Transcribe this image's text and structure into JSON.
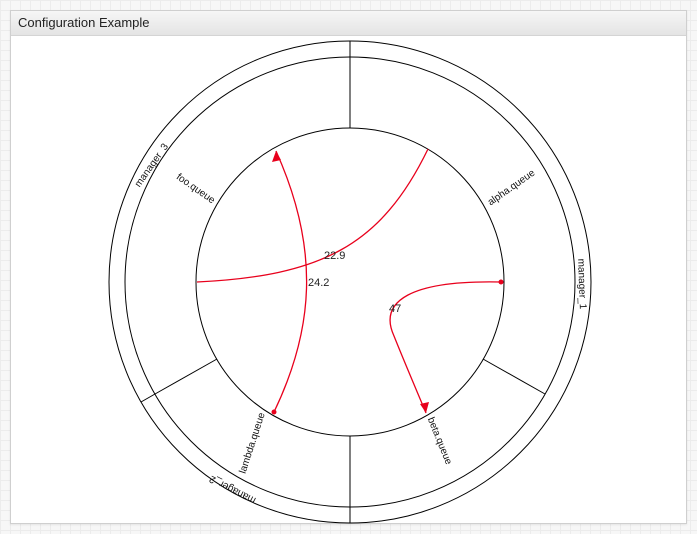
{
  "widget": {
    "title": "Configuration Example"
  },
  "chord": {
    "managers": [
      "manager_1",
      "manager_2",
      "manager_3"
    ],
    "queues": [
      "alpha.queue",
      "beta.queue",
      "lambda.queue",
      "foo.queue"
    ],
    "flows": [
      {
        "from": "alpha.queue",
        "to": "beta.queue",
        "value": "47"
      },
      {
        "from": "lambda.queue",
        "to": "foo.queue",
        "value": "24.2"
      },
      {
        "from": "foo.queue",
        "to": "alpha.queue",
        "value": "22.9"
      }
    ],
    "link_color": "#e8001c"
  }
}
